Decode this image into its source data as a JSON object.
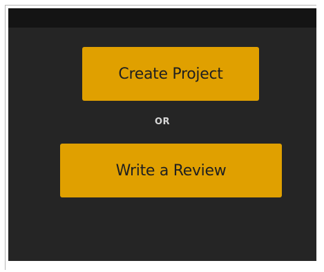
{
  "actions": {
    "create_project_label": "Create Project",
    "separator_label": "OR",
    "write_review_label": "Write a Review"
  },
  "colors": {
    "panel_bg": "#252525",
    "top_bar_bg": "#141414",
    "button_bg": "#e0a000",
    "button_text": "#202020",
    "separator_text": "#d8d8d8"
  }
}
